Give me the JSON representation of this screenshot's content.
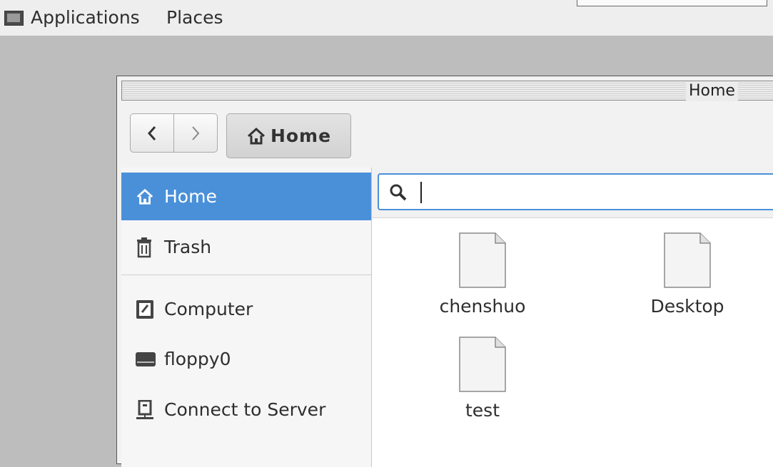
{
  "top_panel": {
    "applications_label": "Applications",
    "places_label": "Places"
  },
  "window": {
    "title": "Home"
  },
  "toolbar": {
    "back_glyph": "‹",
    "forward_glyph": "›",
    "path_label": "Home"
  },
  "sidebar": {
    "items": [
      {
        "label": "Home",
        "icon": "home-icon",
        "active": true
      },
      {
        "label": "Trash",
        "icon": "trash-icon"
      },
      {
        "label": "Computer",
        "icon": "computer-icon"
      },
      {
        "label": "floppy0",
        "icon": "drive-icon"
      },
      {
        "label": "Connect to Server",
        "icon": "server-icon"
      }
    ]
  },
  "search": {
    "value": ""
  },
  "files": [
    {
      "name": "chenshuo",
      "icon": "document-icon"
    },
    {
      "name": "Desktop",
      "icon": "document-icon"
    },
    {
      "name": "test",
      "icon": "document-icon"
    }
  ],
  "colors": {
    "accent": "#4a90d9"
  }
}
